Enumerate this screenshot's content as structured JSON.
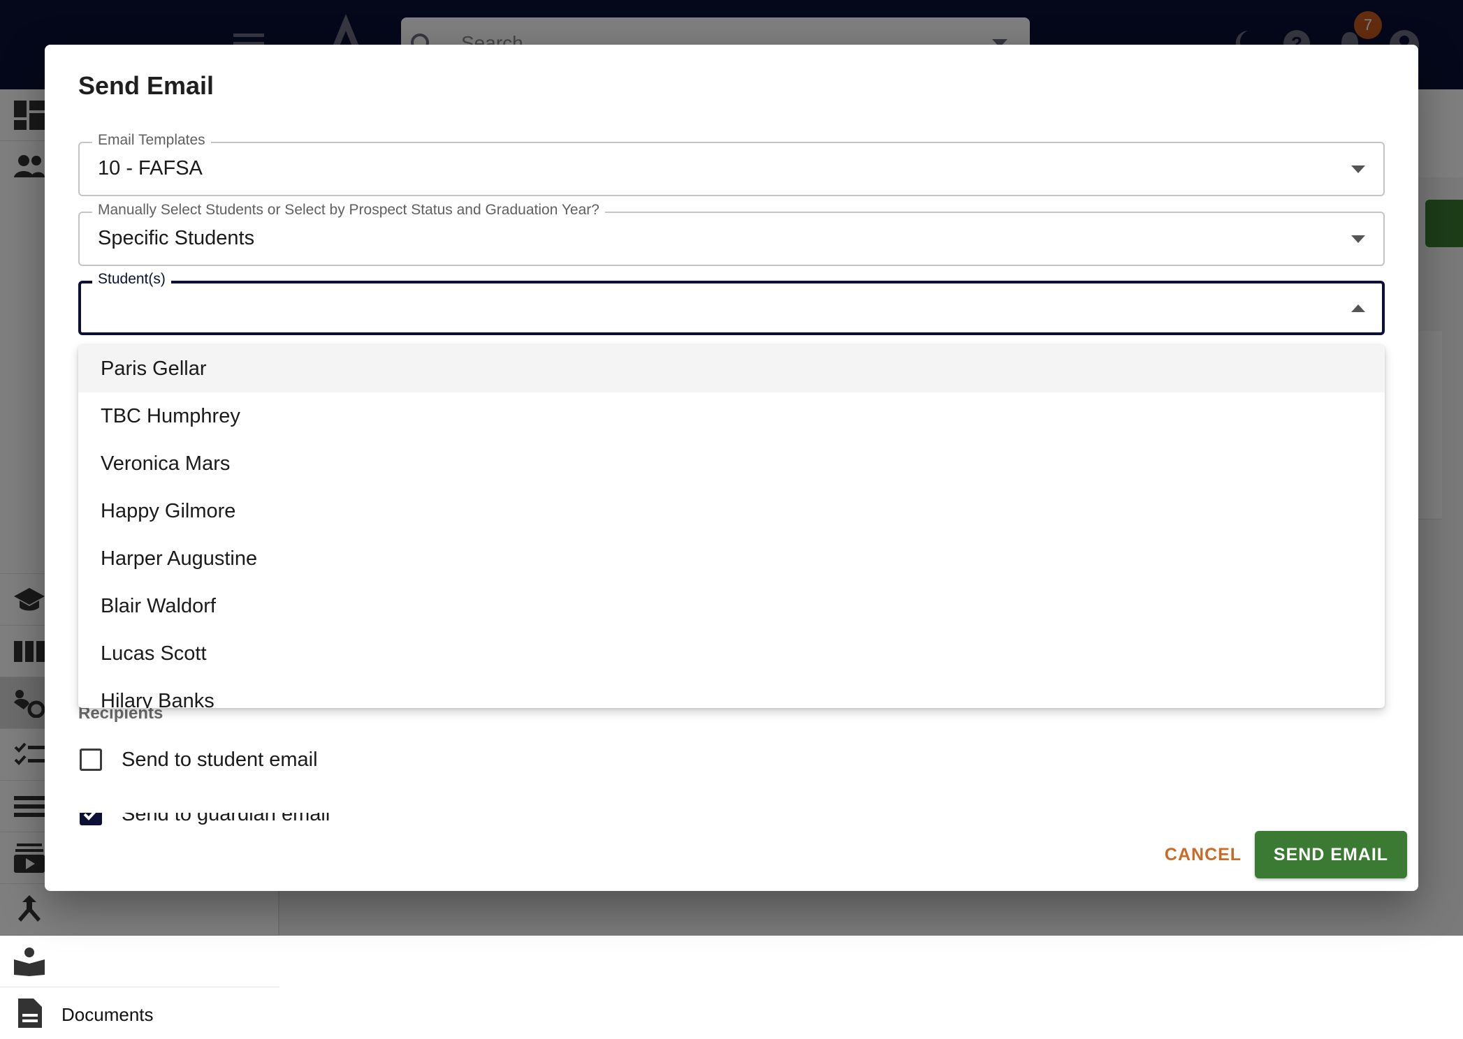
{
  "topbar": {
    "search_placeholder": "Search",
    "notification_count": "7"
  },
  "sidebar": {
    "documents_label": "Documents"
  },
  "dialog": {
    "title": "Send Email",
    "email_templates": {
      "label": "Email Templates",
      "value": "10 - FAFSA"
    },
    "selection_mode": {
      "label": "Manually Select Students or Select by Prospect Status and Graduation Year?",
      "value": "Specific Students"
    },
    "students": {
      "label": "Student(s)",
      "value": "",
      "options": [
        "Paris Gellar",
        "TBC Humphrey",
        "Veronica Mars",
        "Happy Gilmore",
        "Harper Augustine",
        "Blair Waldorf",
        "Lucas Scott",
        "Hilary Banks"
      ]
    },
    "recipients": {
      "label": "Recipients",
      "student_email": {
        "label": "Send to student email",
        "checked": false
      },
      "guardian_email": {
        "label": "Send to guardian email",
        "checked": true
      }
    },
    "actions": {
      "cancel_label": "CANCEL",
      "send_label": "SEND EMAIL"
    }
  },
  "colors": {
    "navy": "#0b1034",
    "green": "#3b7a32",
    "orange": "#c96b27"
  }
}
